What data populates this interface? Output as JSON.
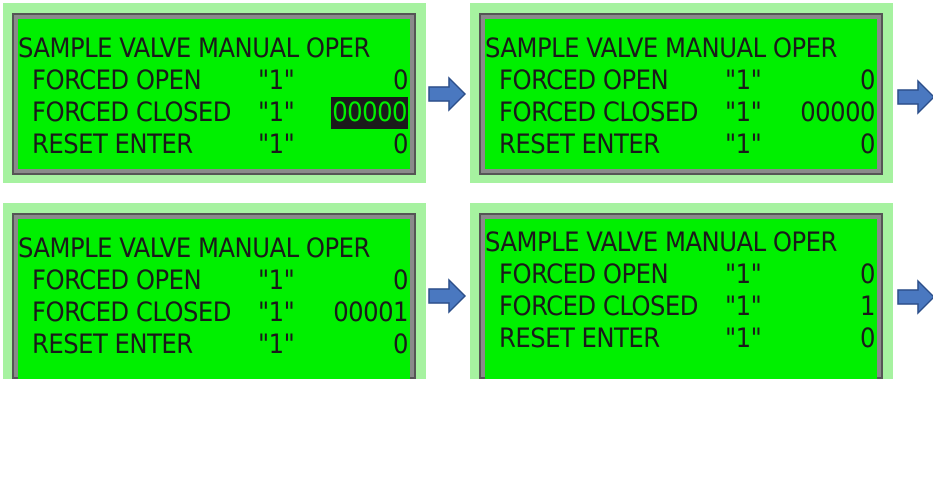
{
  "panels": [
    {
      "title": "SAMPLE VALVE MANUAL OPER",
      "rows": [
        {
          "label": "FORCED OPEN",
          "code": "\"1\"",
          "value": "0",
          "highlight": false
        },
        {
          "label": "FORCED CLOSED",
          "code": "\"1\"",
          "value": "00000",
          "highlight": true
        },
        {
          "label": "RESET ENTER",
          "code": "\"1\"",
          "value": "0",
          "highlight": false
        }
      ]
    },
    {
      "title": "SAMPLE VALVE MANUAL OPER",
      "rows": [
        {
          "label": "FORCED OPEN",
          "code": "\"1\"",
          "value": "0",
          "highlight": false
        },
        {
          "label": "FORCED CLOSED",
          "code": "\"1\"",
          "value": "00000",
          "highlight": false
        },
        {
          "label": "RESET ENTER",
          "code": "\"1\"",
          "value": "0",
          "highlight": false
        }
      ]
    },
    {
      "title": "SAMPLE VALVE MANUAL OPER",
      "rows": [
        {
          "label": "FORCED OPEN",
          "code": "\"1\"",
          "value": "0",
          "highlight": false
        },
        {
          "label": "FORCED CLOSED",
          "code": "\"1\"",
          "value": "00001",
          "highlight": false
        },
        {
          "label": "RESET ENTER",
          "code": "\"1\"",
          "value": "0",
          "highlight": false
        }
      ]
    },
    {
      "title": "SAMPLE VALVE MANUAL OPER",
      "rows": [
        {
          "label": "FORCED OPEN",
          "code": "\"1\"",
          "value": "0",
          "highlight": false
        },
        {
          "label": "FORCED CLOSED",
          "code": "\"1\"",
          "value": "1",
          "highlight": false
        },
        {
          "label": "RESET ENTER",
          "code": "\"1\"",
          "value": "0",
          "highlight": false
        }
      ]
    }
  ],
  "colors": {
    "lcd_background": "#00f000",
    "text": "#1a1a1a",
    "frame": "#a6f2a0",
    "bezel": "#8a8a8a",
    "arrow": "#4a78c0"
  },
  "icons": {
    "arrow": "right-arrow-icon"
  }
}
